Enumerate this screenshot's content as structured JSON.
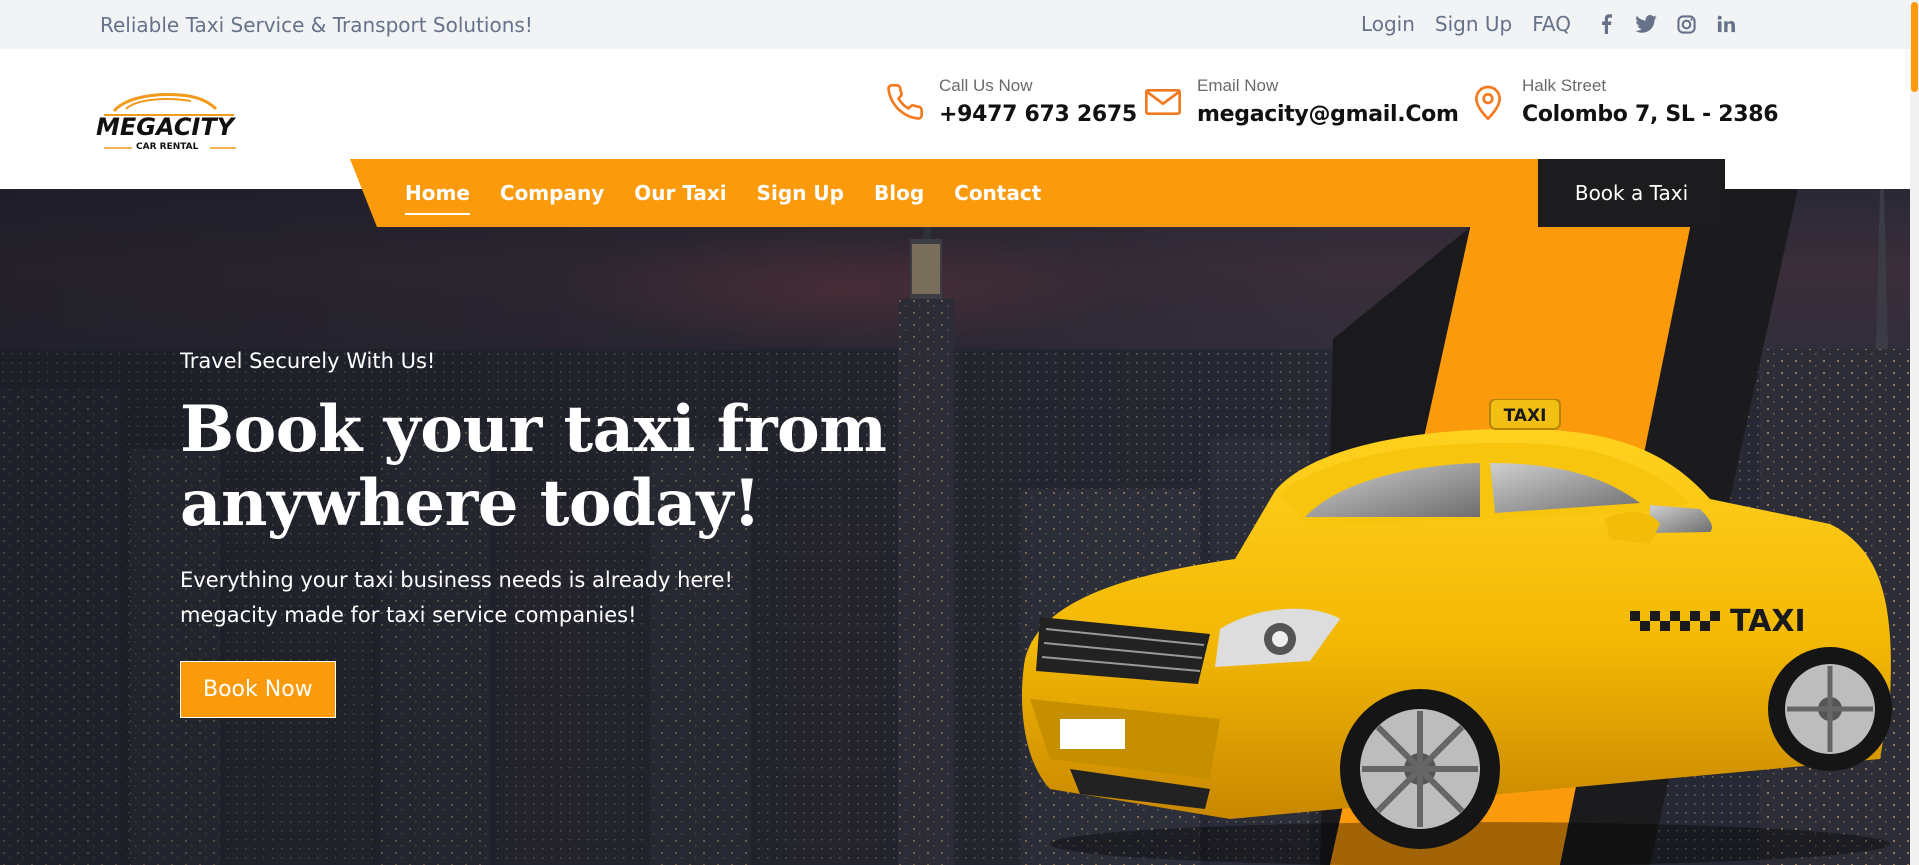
{
  "topbar": {
    "tagline": "Reliable Taxi Service & Transport Solutions!",
    "links": [
      "Login",
      "Sign Up",
      "FAQ"
    ],
    "social_icons": [
      "facebook-icon",
      "twitter-icon",
      "instagram-icon",
      "linkedin-icon"
    ]
  },
  "logo": {
    "brand": "MEGACITY",
    "tagline": "CAR RENTAL"
  },
  "contacts": [
    {
      "icon": "phone-icon",
      "label": "Call Us Now",
      "value": "+9477 673 2675"
    },
    {
      "icon": "mail-icon",
      "label": "Email Now",
      "value": "megacity@gmail.Com"
    },
    {
      "icon": "location-pin-icon",
      "label": "Halk Street",
      "value": "Colombo 7, SL - 2386"
    }
  ],
  "nav": {
    "items": [
      "Home",
      "Company",
      "Our Taxi",
      "Sign Up",
      "Blog",
      "Contact"
    ],
    "active": "Home",
    "cta": "Book a Taxi"
  },
  "hero": {
    "subtitle": "Travel Securely With Us!",
    "title_line1": "Book your taxi from",
    "title_line2": "anywhere today!",
    "desc_line1": "Everything your taxi business needs is already here!",
    "desc_line2": "megacity made for taxi service companies!",
    "button": "Book Now",
    "taxi_sign": "TAXI",
    "door_text": "TAXI"
  },
  "colors": {
    "accent": "#fb9a0b",
    "dark": "#1c1c1e",
    "muted": "#66728a"
  }
}
